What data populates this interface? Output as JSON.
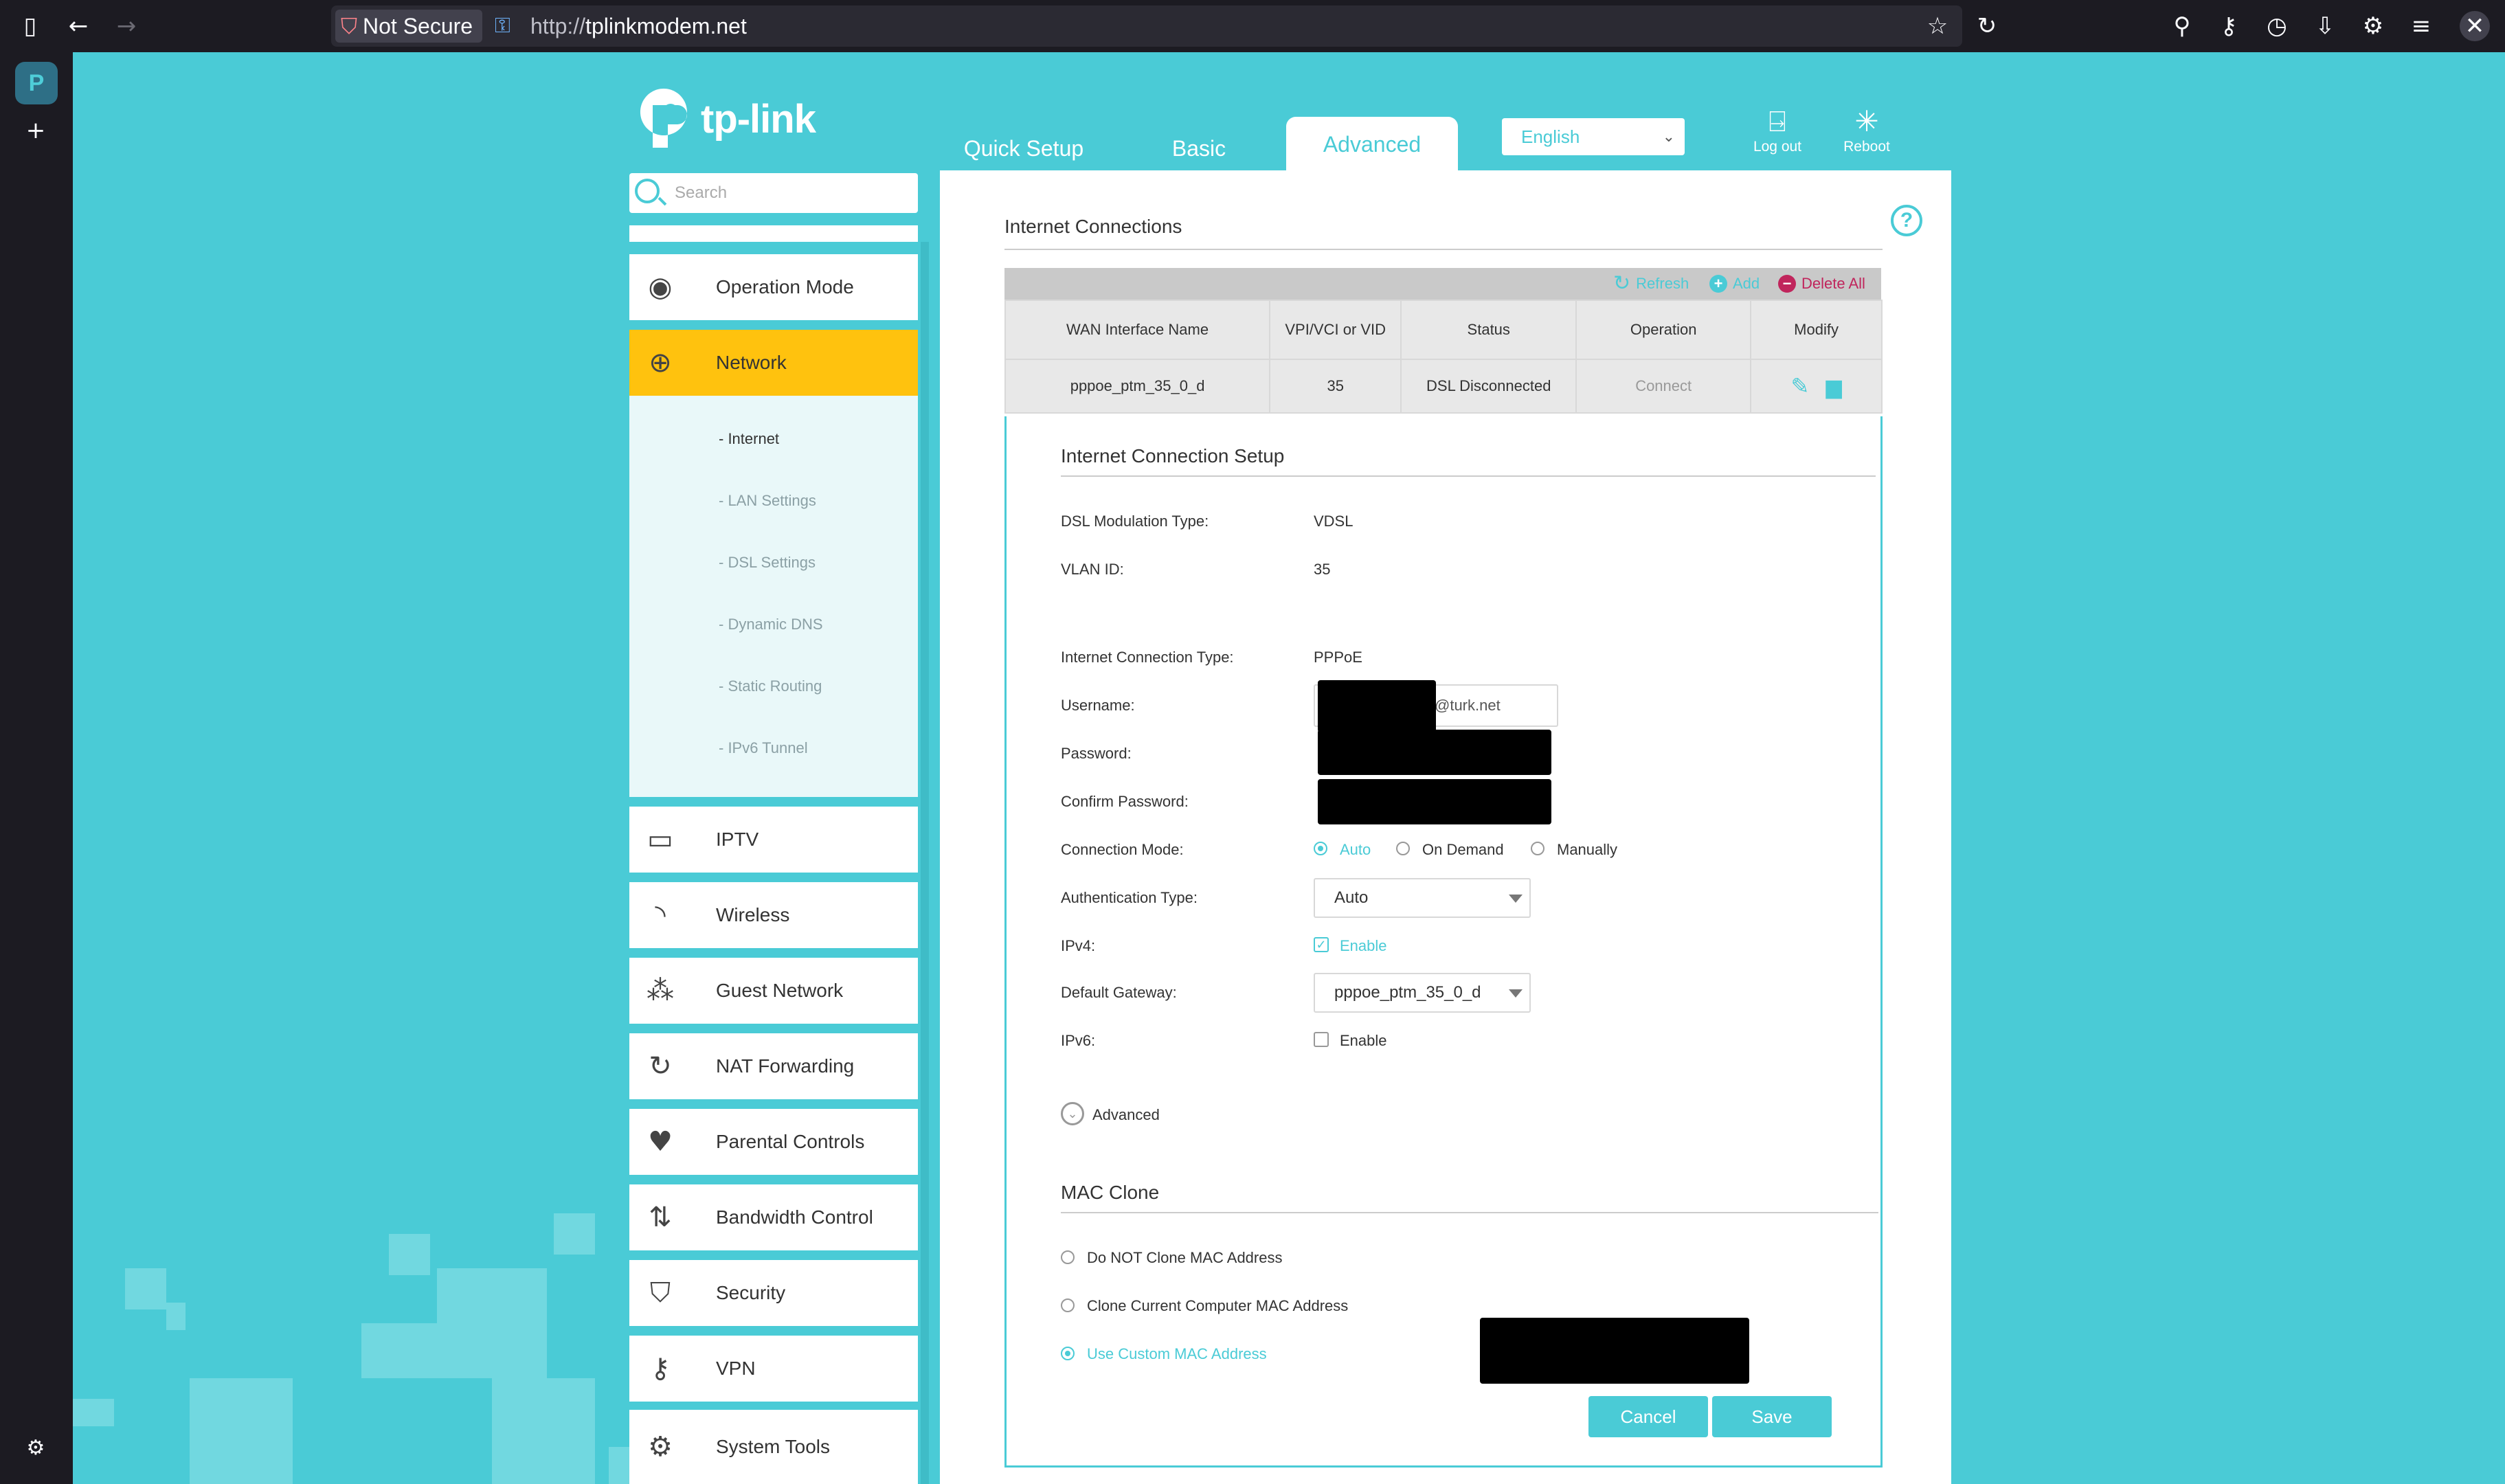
{
  "browser": {
    "security_label": "Not Secure",
    "url_prefix": "http://",
    "url_host": "tplinkmodem.net"
  },
  "header": {
    "logo_text": "tp-link",
    "tabs": [
      {
        "label": "Quick Setup"
      },
      {
        "label": "Basic"
      },
      {
        "label": "Advanced"
      }
    ],
    "language": "English",
    "logout_label": "Log out",
    "reboot_label": "Reboot"
  },
  "sidebar": {
    "search_placeholder": "Search",
    "items": [
      {
        "label": "Operation Mode",
        "icon": "toggle-icon"
      },
      {
        "label": "Network",
        "icon": "globe-icon"
      },
      {
        "label": "IPTV",
        "icon": "monitor-icon"
      },
      {
        "label": "Wireless",
        "icon": "wifi-icon"
      },
      {
        "label": "Guest Network",
        "icon": "guests-icon"
      },
      {
        "label": "NAT Forwarding",
        "icon": "nat-icon"
      },
      {
        "label": "Parental Controls",
        "icon": "heart-icon"
      },
      {
        "label": "Bandwidth Control",
        "icon": "arrows-icon"
      },
      {
        "label": "Security",
        "icon": "shield-icon"
      },
      {
        "label": "VPN",
        "icon": "key-icon"
      },
      {
        "label": "System Tools",
        "icon": "gear-icon"
      }
    ],
    "network_sub": [
      "- Internet",
      "- LAN Settings",
      "- DSL Settings",
      "- Dynamic DNS",
      "- Static Routing",
      "- IPv6 Tunnel"
    ]
  },
  "main": {
    "section_title": "Internet Connections",
    "toolbar": {
      "refresh": "Refresh",
      "add": "Add",
      "delete_all": "Delete All"
    },
    "table": {
      "headers": [
        "WAN Interface Name",
        "VPI/VCI or VID",
        "Status",
        "Operation",
        "Modify"
      ],
      "rows": [
        {
          "name": "pppoe_ptm_35_0_d",
          "vid": "35",
          "status": "DSL Disconnected",
          "operation": "Connect"
        }
      ]
    },
    "setup": {
      "title": "Internet Connection Setup",
      "dsl_mod_label": "DSL Modulation Type:",
      "dsl_mod_value": "VDSL",
      "vlan_label": "VLAN ID:",
      "vlan_value": "35",
      "conn_type_label": "Internet Connection Type:",
      "conn_type_value": "PPPoE",
      "username_label": "Username:",
      "username_suffix": "@turk.net",
      "password_label": "Password:",
      "confirm_label": "Confirm Password:",
      "conn_mode_label": "Connection Mode:",
      "conn_modes": [
        "Auto",
        "On Demand",
        "Manually"
      ],
      "auth_label": "Authentication Type:",
      "auth_value": "Auto",
      "ipv4_label": "IPv4:",
      "ipv4_enable": "Enable",
      "gateway_label": "Default Gateway:",
      "gateway_value": "pppoe_ptm_35_0_d",
      "ipv6_label": "IPv6:",
      "ipv6_enable": "Enable",
      "advanced_label": "Advanced"
    },
    "mac": {
      "title": "MAC Clone",
      "options": [
        "Do NOT Clone MAC Address",
        "Clone Current Computer MAC Address",
        "Use Custom MAC Address"
      ]
    },
    "buttons": {
      "cancel": "Cancel",
      "save": "Save"
    }
  },
  "colors": {
    "accent": "#4acbd6",
    "active_menu": "#ffc20e",
    "delete": "#c0255c"
  }
}
